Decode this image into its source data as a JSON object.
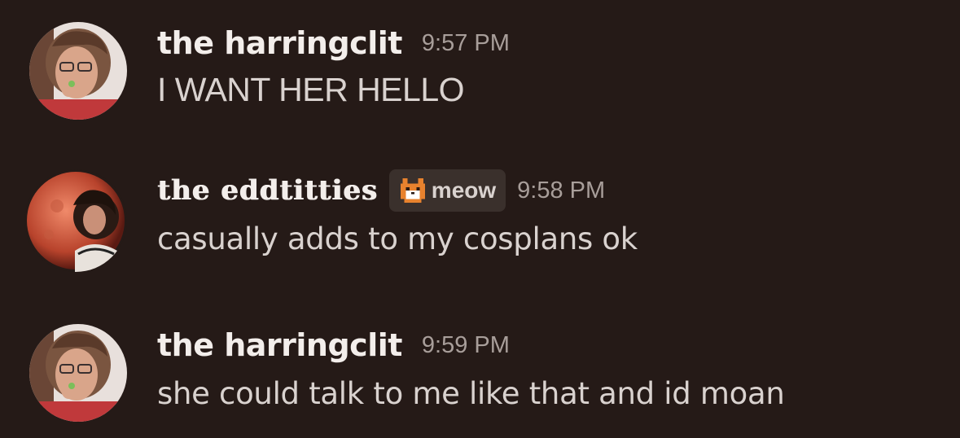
{
  "messages": [
    {
      "author": "the harringclit",
      "time": "9:57 PM",
      "text": "I WANT HER HELLO",
      "avatar_icon": "avatar-photo-curly-hair-glasses"
    },
    {
      "author": "the eddtitties",
      "tag": {
        "label": "meow",
        "icon": "pixel-cat-icon"
      },
      "time": "9:58 PM",
      "text": "casually adds to my cosplans ok",
      "avatar_icon": "avatar-photo-red-moon-curly-hair"
    },
    {
      "author": "the harringclit",
      "time": "9:59 PM",
      "text": "she could talk to me like that and id moan",
      "avatar_icon": "avatar-photo-curly-hair-glasses"
    }
  ],
  "colors": {
    "background": "#251a17",
    "username": "#f3eeeb",
    "message_text": "#d9d2cf",
    "timestamp": "#a89e9a",
    "tag_background": "#3a302c"
  }
}
